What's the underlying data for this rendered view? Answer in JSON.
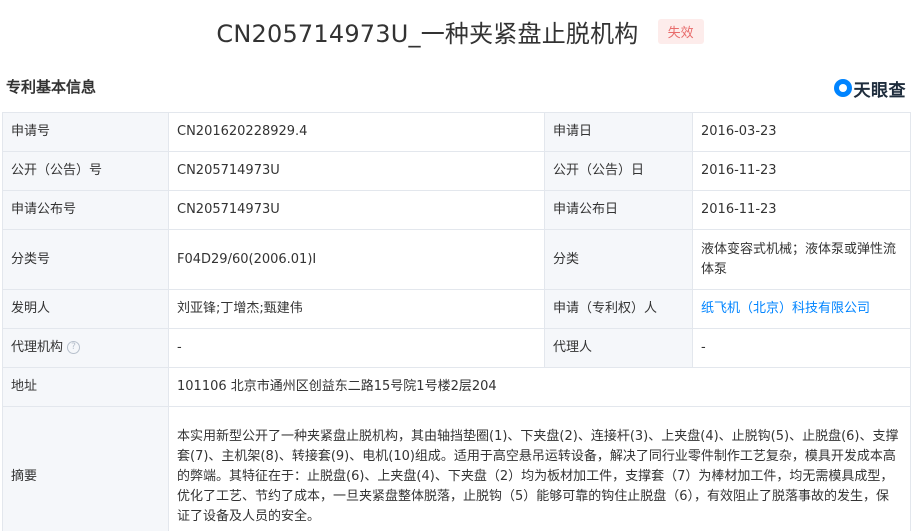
{
  "header": {
    "title": "CN205714973U_一种夹紧盘止脱机构",
    "status_badge": "失效"
  },
  "section": {
    "title": "专利基本信息",
    "brand": "天眼查"
  },
  "rows": {
    "r1": {
      "l1": "申请号",
      "v1": "CN201620228929.4",
      "l2": "申请日",
      "v2": "2016-03-23"
    },
    "r2": {
      "l1": "公开（公告）号",
      "v1": "CN205714973U",
      "l2": "公开（公告）日",
      "v2": "2016-11-23"
    },
    "r3": {
      "l1": "申请公布号",
      "v1": "CN205714973U",
      "l2": "申请公布日",
      "v2": "2016-11-23"
    },
    "r4": {
      "l1": "分类号",
      "v1": "F04D29/60(2006.01)I",
      "l2": "分类",
      "v2": "液体变容式机械；液体泵或弹性流体泵"
    },
    "r5": {
      "l1": "发明人",
      "v1": "刘亚锋;丁增杰;甄建伟",
      "l2": "申请（专利权）人",
      "v2": "纸飞机（北京）科技有限公司"
    },
    "r6": {
      "l1": "代理机构",
      "v1": "-",
      "l2": "代理人",
      "v2": "-"
    },
    "r7": {
      "l1": "地址",
      "v1": "101106 北京市通州区创益东二路15号院1号楼2层204"
    },
    "r8": {
      "l1": "摘要",
      "v1": "本实用新型公开了一种夹紧盘止脱机构，其由轴挡垫圈(1)、下夹盘(2)、连接杆(3)、上夹盘(4)、止脱钩(5)、止脱盘(6)、支撑套(7)、主机架(8)、转接套(9)、电机(10)组成。适用于高空悬吊运转设备，解决了同行业零件制作工艺复杂，模具开发成本高的弊端。其特征在于：止脱盘(6)、上夹盘(4)、下夹盘（2）均为板材加工件，支撑套（7）为棒材加工件，均无需模具成型，优化了工艺、节约了成本，一旦夹紧盘整体脱落，止脱钩（5）能够可靠的钩住止脱盘（6），有效阻止了脱落事故的发生，保证了设备及人员的安全。"
    }
  },
  "icons": {
    "help": "?",
    "help_name": "question-circle-icon",
    "brand_logo": "tianyancha-logo-icon"
  },
  "colors": {
    "label_bg": "#f5f7fa",
    "border": "#e3e7ed",
    "link": "#0084ff",
    "badge_bg": "#fdeceb",
    "badge_text": "#e86c6c"
  }
}
